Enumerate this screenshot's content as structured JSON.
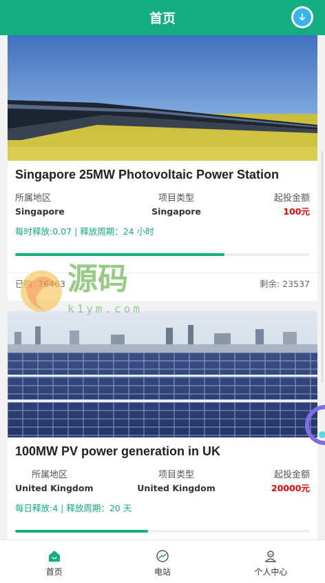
{
  "header": {
    "title": "首页",
    "download_icon": "download-circle-icon"
  },
  "projects": [
    {
      "title": "Singapore 25MW Photovoltaic Power Station",
      "region_label": "所属地区",
      "region_value": "Singapore",
      "type_label": "项目类型",
      "type_value": "Singapore",
      "min_label": "起投金额",
      "min_value": "100元",
      "release_text": "每时释放:0.07 | 释放周期：24 小时",
      "progress": 0.71,
      "purchased": "已购: 76463",
      "remaining": "剩余: 23537"
    },
    {
      "title": "100MW PV power generation in UK",
      "region_label": "所属地区",
      "region_value": "United Kingdom",
      "type_label": "项目类型",
      "type_value": "United Kingdom",
      "min_label": "起投金额",
      "min_value": "20000元",
      "release_text": "每日释放:4 | 释放周期：20 天",
      "progress": 0.45
    }
  ],
  "watermark": {
    "brand": "源码",
    "site": "k1ym.com"
  },
  "tabbar": [
    {
      "label": "首页",
      "icon": "home-icon",
      "active": true
    },
    {
      "label": "电站",
      "icon": "station-icon",
      "active": false
    },
    {
      "label": "个人中心",
      "icon": "user-icon",
      "active": false
    }
  ],
  "colors": {
    "primary": "#12ad80",
    "price": "#e00000",
    "download": "#36b4f0"
  }
}
